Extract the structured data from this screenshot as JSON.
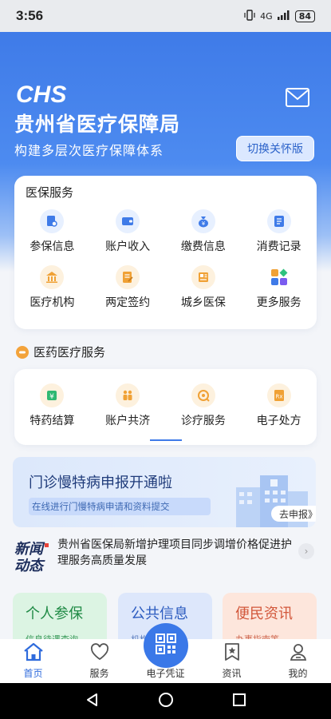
{
  "status": {
    "time": "3:56",
    "network": "4G",
    "battery": "84"
  },
  "header": {
    "logo_text": "CHS",
    "title": "贵州省医疗保障局",
    "subtitle": "构建多层次医疗保障体系",
    "care_mode_button": "切换关怀版"
  },
  "services": {
    "title": "医保服务",
    "items": [
      {
        "label": "参保信息",
        "icon": "file-search-icon",
        "bg": "#e7f0ff",
        "fg": "#3f7be8"
      },
      {
        "label": "账户收入",
        "icon": "wallet-icon",
        "bg": "#e7f0ff",
        "fg": "#3f7be8"
      },
      {
        "label": "缴费信息",
        "icon": "money-bag-icon",
        "bg": "#e7f0ff",
        "fg": "#3f7be8"
      },
      {
        "label": "消费记录",
        "icon": "receipt-icon",
        "bg": "#e7f0ff",
        "fg": "#3f7be8"
      },
      {
        "label": "医疗机构",
        "icon": "building-icon",
        "bg": "#fdf1de",
        "fg": "#f0a135"
      },
      {
        "label": "两定签约",
        "icon": "contract-icon",
        "bg": "#fdf1de",
        "fg": "#f0a135"
      },
      {
        "label": "城乡医保",
        "icon": "id-card-icon",
        "bg": "#fdf1de",
        "fg": "#f0a135"
      },
      {
        "label": "更多服务",
        "icon": "grid-icon",
        "bg": "#ffffff",
        "fg": "#3f7be8"
      }
    ]
  },
  "medical": {
    "title": "医药医疗服务",
    "items": [
      {
        "label": "特药结算",
        "icon": "pill-icon"
      },
      {
        "label": "账户共济",
        "icon": "family-icon"
      },
      {
        "label": "诊疗服务",
        "icon": "stethoscope-icon"
      },
      {
        "label": "电子处方",
        "icon": "prescription-icon"
      }
    ]
  },
  "banner": {
    "title": "门诊慢特病申报开通啦",
    "subtitle": "在线进行门慢特病申请和资料提交",
    "button": "去申报》"
  },
  "news": {
    "logo_line1": "新闻",
    "logo_line2": "动态",
    "text": "贵州省医保局新增护理项目同步调增价格促进护理服务高质量发展"
  },
  "tiles": [
    {
      "title": "个人参保",
      "sub": "信息待遇查询"
    },
    {
      "title": "公共信息",
      "sub": "机构目录"
    },
    {
      "title": "便民资讯",
      "sub": "办事指南等"
    }
  ],
  "tabbar": {
    "home": "首页",
    "services": "服务",
    "voucher": "电子凭证",
    "news": "资讯",
    "mine": "我的"
  },
  "colors": {
    "primary": "#3f7be8",
    "accent_orange": "#f0a135"
  }
}
